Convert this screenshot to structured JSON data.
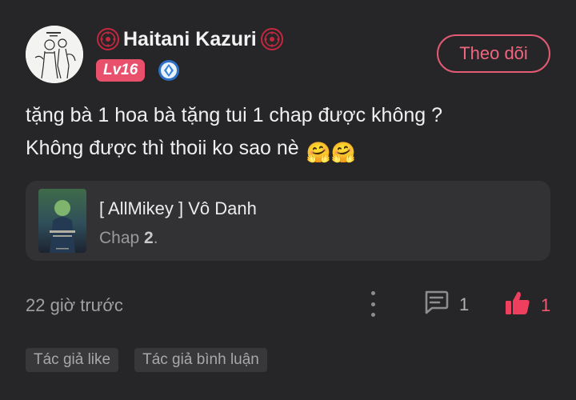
{
  "user": {
    "name": "Haitani Kazuri",
    "level": "Lv16",
    "avatar_icon": "manga-sketch-avatar",
    "rank_icon": "diamond-rank-icon"
  },
  "follow_button": {
    "label": "Theo dõi"
  },
  "comment": {
    "line1": "tặng bà 1 hoa bà tặng tui 1 chap được không ?",
    "line2": "Không được thì thoii ko sao nè",
    "emoji": "🤗🤗"
  },
  "manga": {
    "title": "[ AllMikey ] Vô Danh",
    "chapter_prefix": "Chap",
    "chapter_number": "2",
    "chapter_suffix": "."
  },
  "footer": {
    "timestamp": "22 giờ trước",
    "reply_count": "1",
    "like_count": "1"
  },
  "tags": [
    "Tác giả like",
    "Tác giả bình luận"
  ],
  "colors": {
    "background": "#262628",
    "accent": "#e8506c",
    "card": "#323235"
  }
}
